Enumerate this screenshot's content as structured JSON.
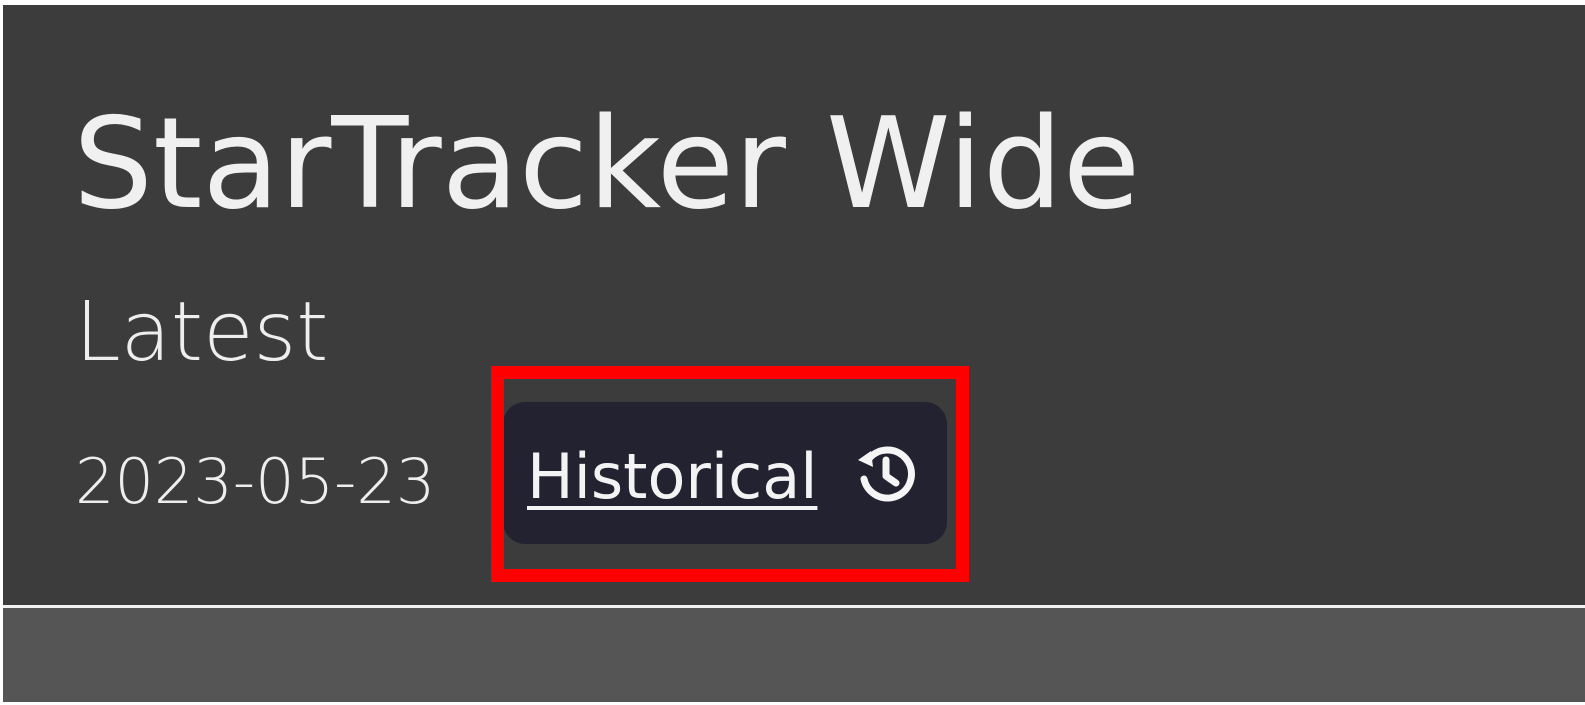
{
  "header": {
    "title": "StarTracker Wide",
    "subtitle": "Latest",
    "date": "2023-05-23",
    "historical_label": "Historical",
    "historical_icon": "history-icon"
  },
  "colors": {
    "panel_background": "#3c3c3c",
    "button_background": "#232230",
    "highlight": "#ff0000",
    "footer_background": "#555555",
    "text": "#f0f0f0"
  }
}
